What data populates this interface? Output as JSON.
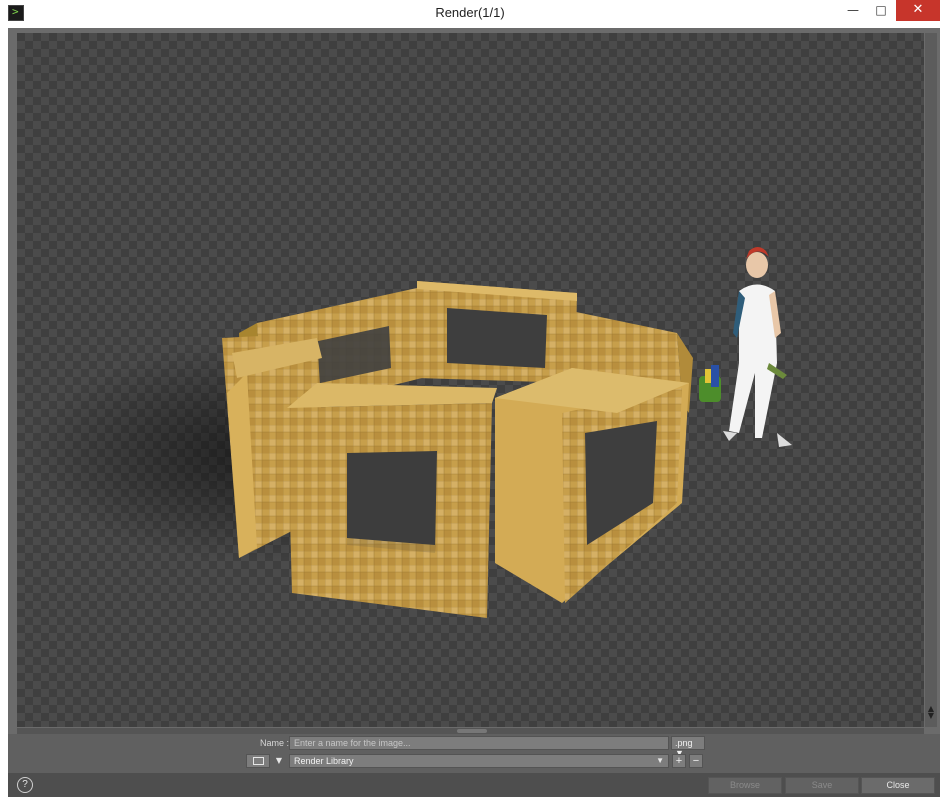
{
  "window": {
    "title": "Render(1/1)",
    "minimize_glyph": "—",
    "maximize_glyph": "□",
    "close_glyph": "✕"
  },
  "app_icon": "daz-studio-icon",
  "render": {
    "subject": "render-image"
  },
  "save_panel": {
    "name_label": "Name :",
    "name_placeholder": "Enter a name for the image...",
    "name_value": "",
    "format_value": ".png ▼",
    "library_value": "Render Library",
    "add_label": "+",
    "remove_label": "−"
  },
  "footer": {
    "help_label": "?",
    "browse_label": "Browse",
    "save_label": "Save",
    "close_label": "Close"
  },
  "colors": {
    "tile": "#c9a34f",
    "tile_dark": "#9c7a33",
    "close_accent": "#c7352b"
  }
}
